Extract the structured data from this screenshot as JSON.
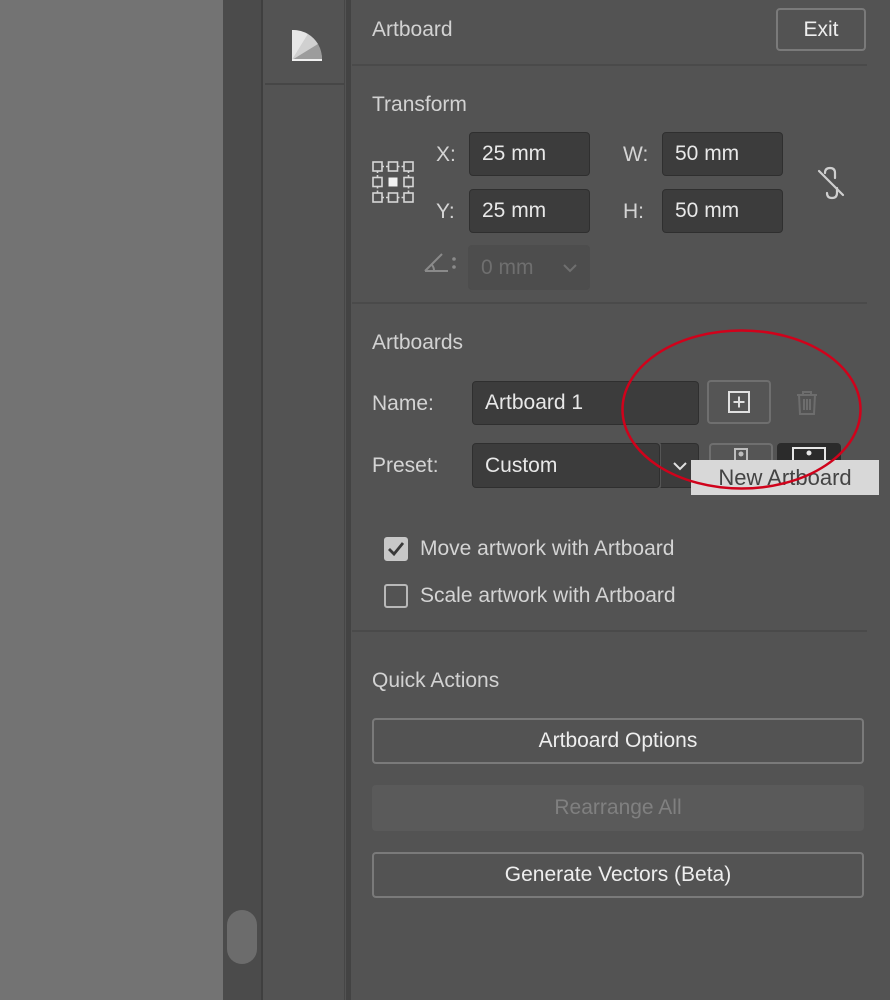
{
  "panel": {
    "title": "Artboard",
    "exit_label": "Exit"
  },
  "transform": {
    "heading": "Transform",
    "x_label": "X:",
    "x_value": "25 mm",
    "y_label": "Y:",
    "y_value": "25 mm",
    "w_label": "W:",
    "w_value": "50 mm",
    "h_label": "H:",
    "h_value": "50 mm",
    "angle_value": "0 mm"
  },
  "artboards": {
    "heading": "Artboards",
    "name_label": "Name:",
    "name_value": "Artboard 1",
    "preset_label": "Preset:",
    "preset_value": "Custom",
    "tooltip": "New Artboard",
    "move_artwork_label": "Move artwork with Artboard",
    "move_artwork_checked": true,
    "scale_artwork_label": "Scale artwork with Artboard",
    "scale_artwork_checked": false
  },
  "quick_actions": {
    "heading": "Quick Actions",
    "artboard_options": "Artboard Options",
    "rearrange_all": "Rearrange All",
    "generate_vectors": "Generate Vectors (Beta)"
  },
  "colors": {
    "annotation": "#d0021b",
    "panel_bg": "#535353",
    "canvas_bg": "#737373"
  }
}
